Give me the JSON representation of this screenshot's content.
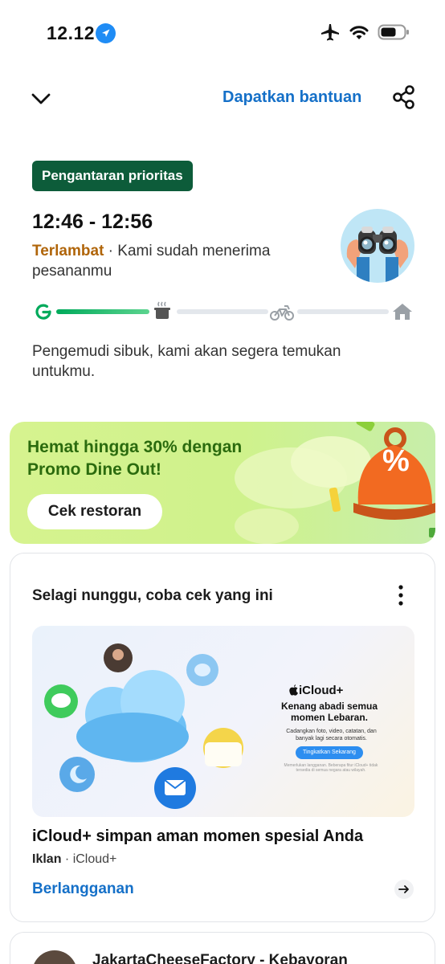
{
  "status_bar": {
    "time": "12.12"
  },
  "header": {
    "help_label": "Dapatkan bantuan"
  },
  "order": {
    "badge": "Pengantaran prioritas",
    "eta": "12:46 - 12:56",
    "status_label": "Terlambat",
    "status_separator": " · ",
    "status_text": "Kami sudah menerima pesananmu",
    "progress": {
      "current_step": 1,
      "total_steps": 4
    },
    "driver_message": "Pengemudi sibuk, kami akan segera temukan untukmu."
  },
  "promo": {
    "title": "Hemat hingga 30% dengan Promo Dine Out!",
    "button_label": "Cek restoran",
    "badge_symbol": "%"
  },
  "ad_card": {
    "section_title": "Selagi nunggu, coba cek yang ini",
    "image": {
      "brand": "iCloud+",
      "headline": "Kenang abadi semua momen Lebaran.",
      "subtext": "Cadangkan foto, video, catatan, dan banyak lagi secara otomatis.",
      "cta": "Tingkatkan Sekarang",
      "fine_print": "Memerlukan langganan. Beberapa fitur iCloud+ tidak tersedia di semua negara atau wilayah."
    },
    "title": "iCloud+ simpan aman momen spesial Anda",
    "ad_label": "Iklan",
    "advertiser": "iCloud+",
    "link_label": "Berlangganan"
  },
  "next_card": {
    "title": "JakartaCheeseFactory - Kebayoran"
  },
  "colors": {
    "accent": "#1570c8",
    "brand_green": "#0d5c3a",
    "late": "#b0650a",
    "progress": "#00aa5b"
  }
}
